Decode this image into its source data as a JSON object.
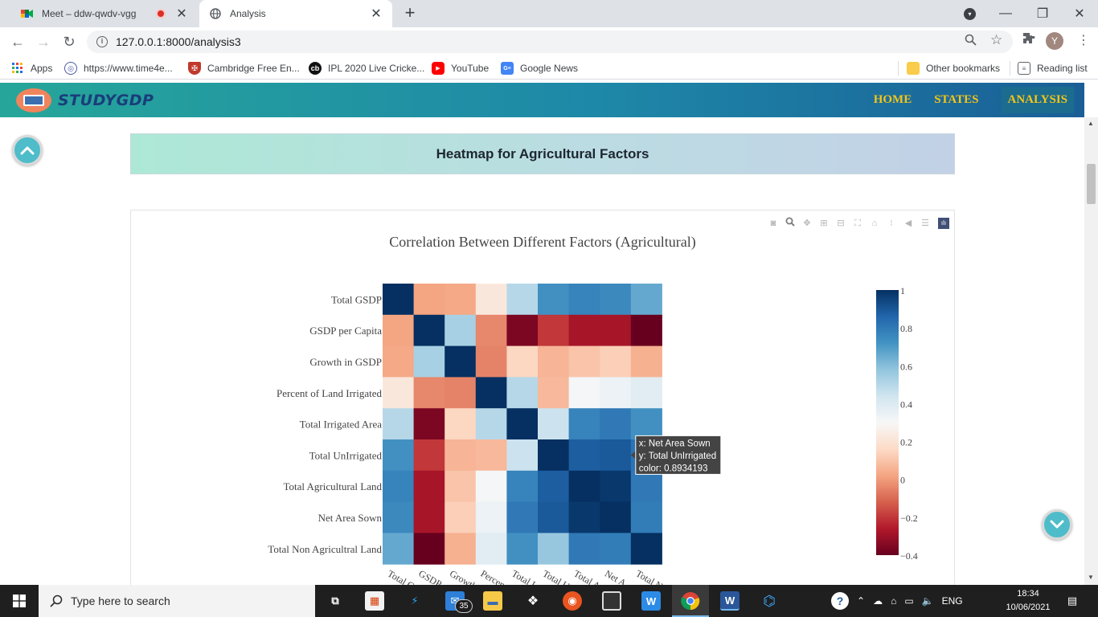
{
  "browser": {
    "tabs": [
      {
        "title": "Meet – ddw-qwdv-vgg",
        "active": false,
        "recording": true
      },
      {
        "title": "Analysis",
        "active": true
      }
    ],
    "url": "127.0.0.1:8000/analysis3",
    "bookmarks": [
      {
        "label": "Apps",
        "icon": "apps-grid-icon"
      },
      {
        "label": "https://www.time4e...",
        "icon": "globe-icon"
      },
      {
        "label": "Cambridge Free En...",
        "icon": "cambridge-shield-icon"
      },
      {
        "label": "IPL 2020 Live Cricke...",
        "icon": "cricket-icon"
      },
      {
        "label": "YouTube",
        "icon": "youtube-icon"
      },
      {
        "label": "Google News",
        "icon": "google-news-icon"
      }
    ],
    "other_bookmarks": "Other bookmarks",
    "reading_list": "Reading list",
    "profile_initial": "Y"
  },
  "site": {
    "brand": "STUDYGDP",
    "nav": [
      {
        "label": "HOME",
        "active": false
      },
      {
        "label": "STATES",
        "active": false
      },
      {
        "label": "ANALYSIS",
        "active": true
      }
    ],
    "section_title": "Heatmap for Agricultural Factors"
  },
  "chart_data": {
    "type": "heatmap",
    "title": "Correlation Between Different Factors (Agricultural)",
    "y_labels": [
      "Total GSDP",
      "GSDP per Capita",
      "Growth in GSDP",
      "Percent of Land Irrigated",
      "Total Irrigated Area",
      "Total UnIrrigated",
      "Total Agricultural Land",
      "Net Area Sown",
      "Total Non Agricultral Land"
    ],
    "x_tick_labels": [
      "Total G",
      "GSDP",
      "Growth",
      "Percen",
      "Total I",
      "Total U",
      "Total A",
      "Net A",
      "Total N"
    ],
    "z": [
      [
        1.0,
        0.02,
        0.03,
        0.22,
        0.5,
        0.73,
        0.77,
        0.75,
        0.66
      ],
      [
        0.02,
        1.0,
        0.53,
        -0.04,
        -0.36,
        -0.2,
        -0.28,
        -0.28,
        -0.4
      ],
      [
        0.03,
        0.53,
        1.0,
        -0.05,
        0.15,
        0.06,
        0.1,
        0.13,
        0.05
      ],
      [
        0.22,
        -0.04,
        -0.05,
        1.0,
        0.5,
        0.07,
        0.31,
        0.34,
        0.38
      ],
      [
        0.5,
        -0.36,
        0.15,
        0.5,
        1.0,
        0.45,
        0.77,
        0.8,
        0.73
      ],
      [
        0.73,
        -0.2,
        0.06,
        0.07,
        0.45,
        1.0,
        0.88,
        0.8934193,
        0.82
      ],
      [
        0.77,
        -0.28,
        0.1,
        0.31,
        0.77,
        0.88,
        1.0,
        0.98,
        0.8
      ],
      [
        0.75,
        -0.28,
        0.13,
        0.34,
        0.8,
        0.8934193,
        0.98,
        1.0,
        0.79
      ],
      [
        0.66,
        -0.4,
        0.05,
        0.38,
        0.73,
        0.57,
        0.8,
        0.79,
        1.0
      ]
    ],
    "zmin": -0.4,
    "zmax": 1,
    "colorscale": "RdBu",
    "colorbar_ticks": [
      "1",
      "0.8",
      "0.6",
      "0.4",
      "0.2",
      "0",
      "−0.2",
      "−0.4"
    ],
    "colorbar_tick_values": [
      1,
      0.8,
      0.6,
      0.4,
      0.2,
      0,
      -0.2,
      -0.4
    ],
    "hover": {
      "row": 5,
      "col": 7,
      "x_line": "x: Net Area Sown",
      "y_line": "y: Total UnIrrigated",
      "color_line": "color: 0.8934193"
    }
  },
  "taskbar": {
    "search_placeholder": "Type here to search",
    "mail_badge": "35",
    "language": "ENG",
    "time": "18:34",
    "date": "10/06/2021"
  }
}
